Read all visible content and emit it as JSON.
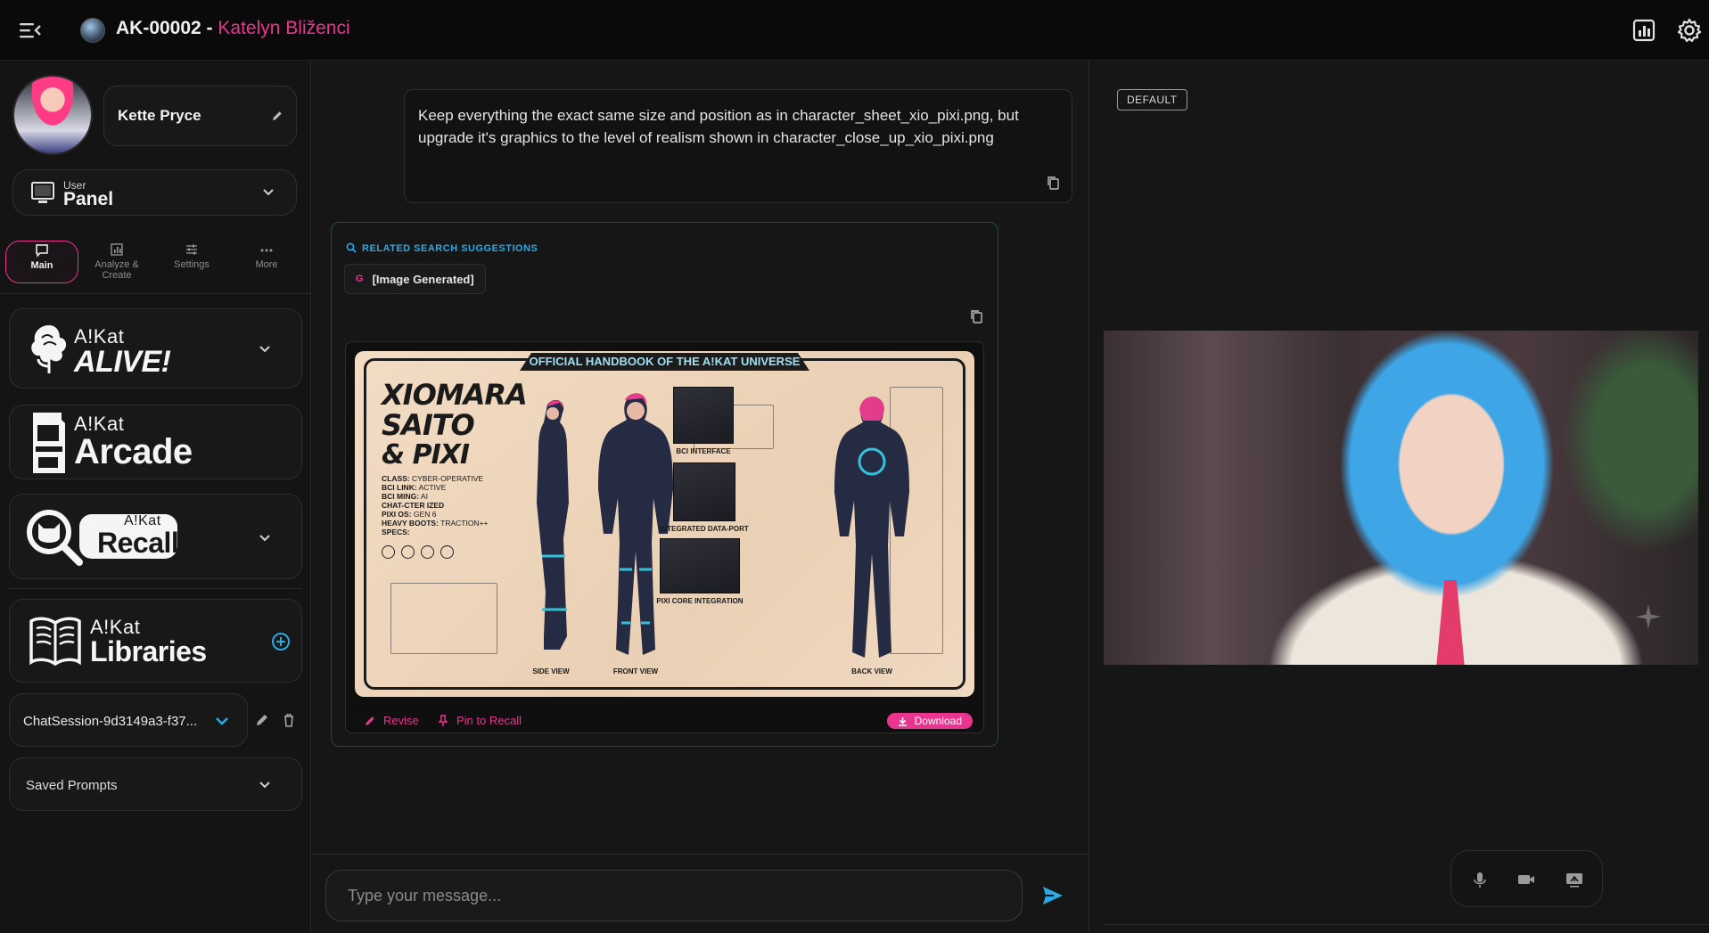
{
  "header": {
    "agent_id": "AK-00002 - ",
    "agent_name": "Katelyn Bliženci"
  },
  "profile": {
    "name": "Kette Pryce"
  },
  "panel_select": {
    "small": "User",
    "big": "Panel"
  },
  "tabs": [
    {
      "label": "Main",
      "icon": "chat-icon",
      "active": true
    },
    {
      "label": "Analyze &\nCreate",
      "icon": "chart-icon",
      "active": false
    },
    {
      "label": "Settings",
      "icon": "sliders-icon",
      "active": false
    },
    {
      "label": "More",
      "icon": "more-icon",
      "active": false
    }
  ],
  "cards": {
    "alive": {
      "small": "A!Kat",
      "large": "ALIVE!"
    },
    "arcade": {
      "small": "A!Kat",
      "large": "Arcade"
    },
    "recall": {
      "small": "A!Kat",
      "large": "Recall"
    },
    "libraries": {
      "small": "A!Kat",
      "large": "Libraries"
    }
  },
  "session": {
    "label": "ChatSession-9d3149a3-f37..."
  },
  "saved_prompts": {
    "label": "Saved Prompts"
  },
  "user_message": {
    "text": "Keep everything the exact same size and position as in character_sheet_xio_pixi.png, but upgrade it's graphics to the level of realism shown in character_close_up_xio_pixi.png"
  },
  "response": {
    "related_title": "RELATED SEARCH SUGGESTIONS",
    "chip_prefix": "G",
    "chip_text": "[Image Generated]",
    "sheet": {
      "banner": "OFFICIAL HANDBOOK OF THE A!KAT UNIVERSE",
      "name_line1": "XIOMARA",
      "name_line2": "SAITO",
      "name_line3": "& PIXI",
      "specs": [
        {
          "k": "CLASS:",
          "v": " CYBER-OPERATIVE"
        },
        {
          "k": "BCI LINK:",
          "v": " ACTIVE"
        },
        {
          "k": "BCI MING:",
          "v": " AI"
        },
        {
          "k": "CHAT-CTER IZED",
          "v": ""
        },
        {
          "k": "PIXI OS:",
          "v": " GEN 6"
        },
        {
          "k": "HEAVY BOOTS:",
          "v": " TRACTION++"
        },
        {
          "k": "SPECS:",
          "v": ""
        }
      ],
      "labels": {
        "side": "SIDE VIEW",
        "front": "FRONT VIEW",
        "back": "BACK VIEW",
        "bci": "BCI INTERFACE",
        "port": "INTEGRATED DATA-PORT",
        "core": "PIXI CORE INTEGRATION"
      }
    },
    "revise": "Revise",
    "pin": "Pin to Recall",
    "download": "Download"
  },
  "composer": {
    "placeholder": "Type your message..."
  },
  "right_panel": {
    "badge": "DEFAULT"
  },
  "colors": {
    "accent": "#e9358f",
    "link_blue": "#2ba9e3"
  }
}
